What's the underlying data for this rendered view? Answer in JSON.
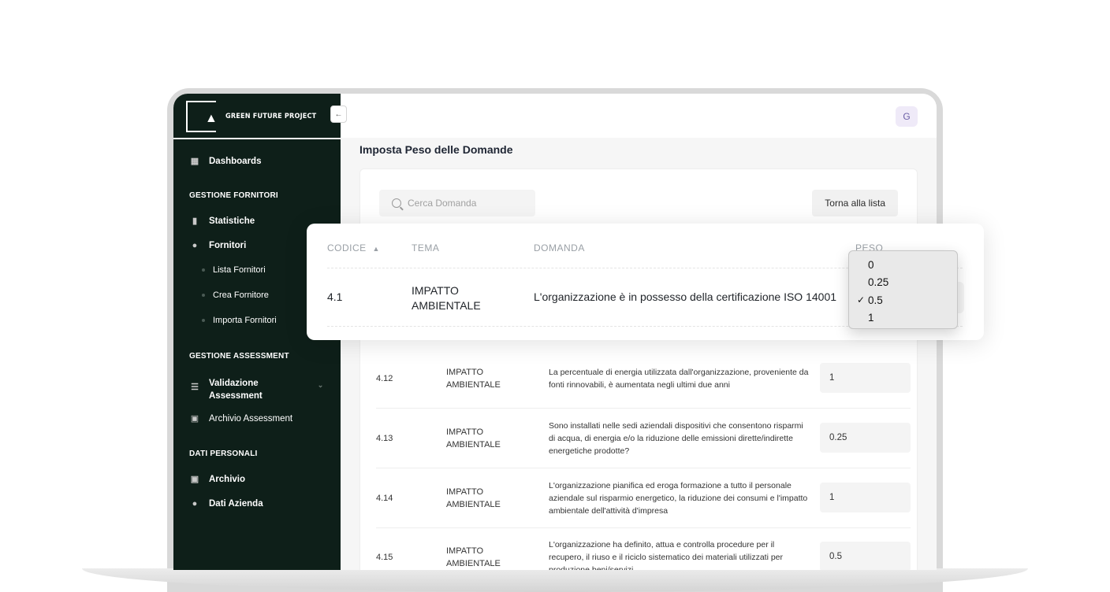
{
  "brand": {
    "name": "GREEN FUTURE PROJECT"
  },
  "sidebar": {
    "collapse_glyph": "←",
    "dashboards": "Dashboards",
    "section_fornitori": "GESTIONE FORNITORI",
    "statistiche": "Statistiche",
    "fornitori": "Fornitori",
    "sub_items": [
      "Lista Fornitori",
      "Crea Fornitore",
      "Importa Fornitori"
    ],
    "section_assessment": "GESTIONE ASSESSMENT",
    "validazione_line1": "Validazione",
    "validazione_line2": "Assessment",
    "archivio_assessment": "Archivio Assessment",
    "section_personali": "DATI PERSONALI",
    "archivio": "Archivio",
    "dati_azienda": "Dati Azienda"
  },
  "topbar": {
    "avatar_initial": "G"
  },
  "page": {
    "title": "Imposta Peso delle Domande",
    "search_placeholder": "Cerca Domanda",
    "back_button": "Torna alla lista"
  },
  "table": {
    "headers": {
      "codice": "CODICE",
      "tema": "TEMA",
      "domanda": "DOMANDA",
      "peso": "PESO"
    },
    "highlight_row": {
      "codice": "4.1",
      "tema_line1": "IMPATTO",
      "tema_line2": "AMBIENTALE",
      "domanda": "L'organizzazione è in possesso della certificazione ISO 14001"
    },
    "rows": [
      {
        "codice": "4.12",
        "tema": "IMPATTO AMBIENTALE",
        "domanda": "La percentuale di energia utilizzata dall'organizzazione, proveniente da fonti rinnovabili, è aumentata negli ultimi due anni",
        "peso": "1"
      },
      {
        "codice": "4.13",
        "tema": "IMPATTO AMBIENTALE",
        "domanda": "Sono installati nelle sedi aziendali dispositivi che consentono risparmi di acqua, di energia e/o la riduzione delle emissioni dirette/indirette energetiche prodotte?",
        "peso": "0.25"
      },
      {
        "codice": "4.14",
        "tema": "IMPATTO AMBIENTALE",
        "domanda": "L'organizzazione pianifica ed eroga formazione a tutto il personale aziendale sul risparmio energetico, la riduzione dei consumi e l'impatto ambientale dell'attività d'impresa",
        "peso": "1"
      },
      {
        "codice": "4.15",
        "tema": "IMPATTO AMBIENTALE",
        "domanda": "L'organizzazione ha definito, attua e controlla procedure per il recupero, il riuso e il riciclo sistematico dei materiali utilizzati per produzione beni/servizi",
        "peso": "0.5"
      }
    ]
  },
  "dropdown": {
    "options": [
      "0",
      "0.25",
      "0.5",
      "1"
    ],
    "selected": "0.5",
    "check_glyph": "✓"
  },
  "colors": {
    "sidebar_bg": "#0e1f19",
    "accent_avatar": "#efeaf8"
  }
}
